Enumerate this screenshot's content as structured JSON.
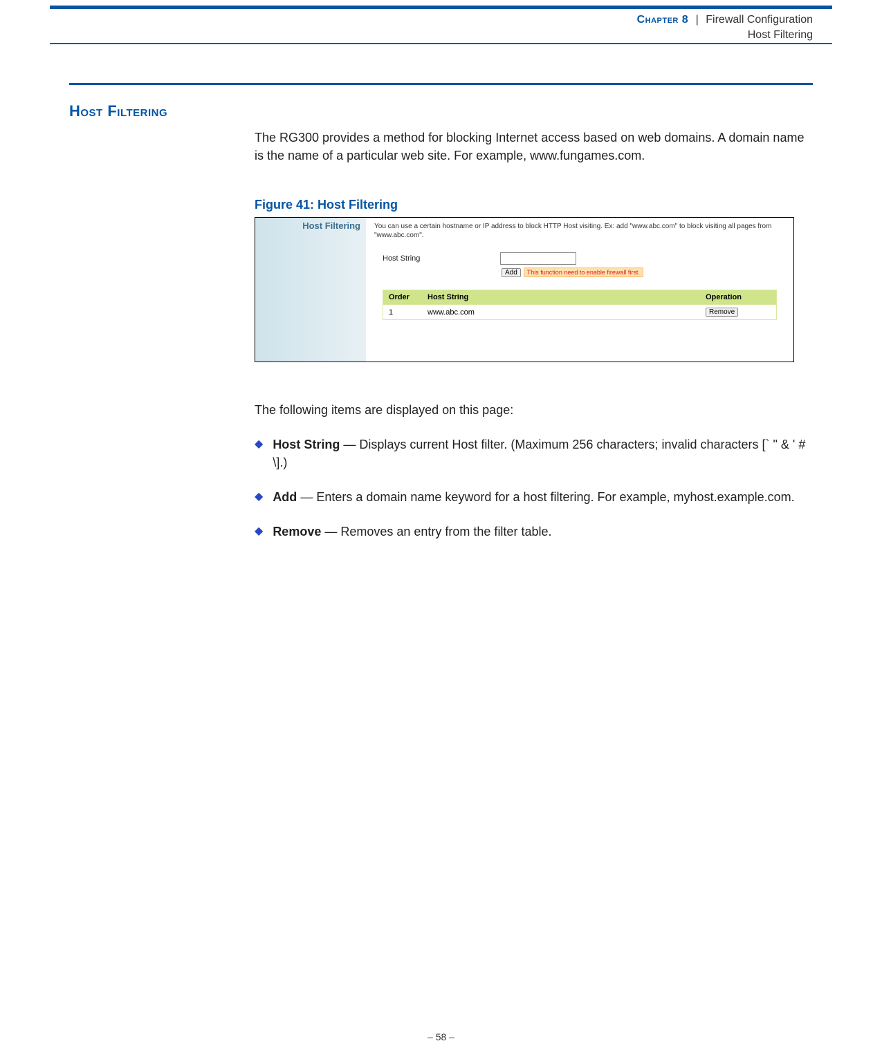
{
  "header": {
    "chapter_label": "Chapter 8",
    "separator": "|",
    "section_title": "Firewall Configuration",
    "subsection_title": "Host Filtering"
  },
  "section_heading": "Host Filtering",
  "intro_paragraph": "The RG300 provides a method for blocking Internet access based on web domains. A domain name is the name of a particular web site. For example, www.fungames.com.",
  "figure": {
    "caption": "Figure 41:  Host Filtering",
    "sidebar_title": "Host Filtering",
    "description": "You can use a certain hostname or IP address to block HTTP Host visiting. Ex: add \"www.abc.com\" to block visiting all pages from \"www.abc.com\".",
    "host_string_label": "Host String",
    "host_string_value": "",
    "add_button": "Add",
    "warning_text": "This function need to enable firewall first.",
    "table": {
      "headers": {
        "order": "Order",
        "host": "Host String",
        "operation": "Operation"
      },
      "rows": [
        {
          "order": "1",
          "host": "www.abc.com",
          "operation": "Remove"
        }
      ]
    }
  },
  "items_intro": "The following items are displayed on this page:",
  "bullets": [
    {
      "term": "Host String",
      "desc": " — Displays current Host filter. (Maximum 256 characters; invalid characters [` \" & ' # \\].)"
    },
    {
      "term": "Add",
      "desc": " — Enters a domain name keyword for a host filtering. For example, myhost.example.com."
    },
    {
      "term": "Remove",
      "desc": " — Removes an entry from the filter table."
    }
  ],
  "page_number": "–  58  –"
}
